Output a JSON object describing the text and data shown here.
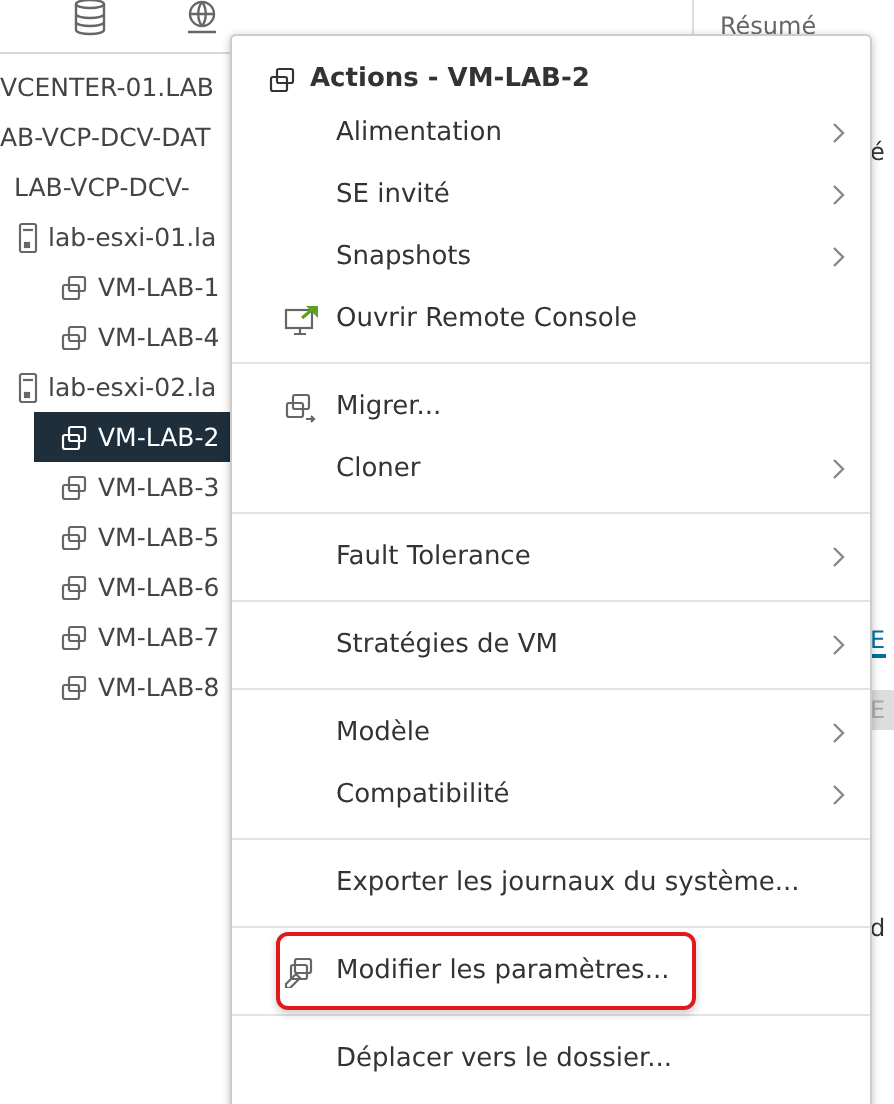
{
  "tree": [
    {
      "label": "VCENTER-01.LAB",
      "children": [
        {
          "label": "AB-VCP-DCV-DAT",
          "children": [
            {
              "label": "LAB-VCP-DCV-",
              "children": [
                {
                  "label": "lab-esxi-01.la",
                  "kind": "host",
                  "children": [
                    {
                      "label": "VM-LAB-1",
                      "kind": "vm",
                      "selected": false
                    },
                    {
                      "label": "VM-LAB-4",
                      "kind": "vm",
                      "selected": false
                    }
                  ]
                },
                {
                  "label": "lab-esxi-02.la",
                  "kind": "host",
                  "children": [
                    {
                      "label": "VM-LAB-2",
                      "kind": "vm",
                      "selected": true
                    },
                    {
                      "label": "VM-LAB-3",
                      "kind": "vm",
                      "selected": false
                    },
                    {
                      "label": "VM-LAB-5",
                      "kind": "vm",
                      "selected": false
                    },
                    {
                      "label": "VM-LAB-6",
                      "kind": "vm",
                      "selected": false
                    },
                    {
                      "label": "VM-LAB-7",
                      "kind": "vm",
                      "selected": false
                    },
                    {
                      "label": "VM-LAB-8",
                      "kind": "vm",
                      "selected": false
                    }
                  ]
                }
              ]
            }
          ]
        }
      ]
    }
  ],
  "right_panel": {
    "tab": "Résumé",
    "fragments": [
      {
        "text": "é",
        "kind": "plain"
      },
      {
        "text": "E",
        "kind": "link"
      },
      {
        "text": "E",
        "kind": "button"
      },
      {
        "text": "d",
        "kind": "plain"
      }
    ]
  },
  "menu": {
    "title": "Actions - VM-LAB-2",
    "sections": [
      [
        {
          "label": "Alimentation",
          "kind": "plain",
          "submenu": true,
          "highlighted": false
        },
        {
          "label": "SE invité",
          "kind": "plain",
          "submenu": true,
          "highlighted": false
        },
        {
          "label": "Snapshots",
          "kind": "plain",
          "submenu": true,
          "highlighted": false
        },
        {
          "label": "Ouvrir Remote Console",
          "kind": "console",
          "submenu": false,
          "highlighted": false
        }
      ],
      [
        {
          "label": "Migrer...",
          "kind": "migrate",
          "submenu": false,
          "highlighted": false
        },
        {
          "label": "Cloner",
          "kind": "plain",
          "submenu": true,
          "highlighted": false
        }
      ],
      [
        {
          "label": "Fault Tolerance",
          "kind": "plain",
          "submenu": true,
          "highlighted": false
        }
      ],
      [
        {
          "label": "Stratégies de VM",
          "kind": "plain",
          "submenu": true,
          "highlighted": false
        }
      ],
      [
        {
          "label": "Modèle",
          "kind": "plain",
          "submenu": true,
          "highlighted": false
        },
        {
          "label": "Compatibilité",
          "kind": "plain",
          "submenu": true,
          "highlighted": false
        }
      ],
      [
        {
          "label": "Exporter les journaux du système...",
          "kind": "plain",
          "submenu": false,
          "highlighted": false
        }
      ],
      [
        {
          "label": "Modifier les paramètres...",
          "kind": "settings",
          "submenu": false,
          "highlighted": true
        }
      ],
      [
        {
          "label": "Déplacer vers le dossier...",
          "kind": "plain",
          "submenu": false,
          "highlighted": false
        }
      ]
    ]
  }
}
